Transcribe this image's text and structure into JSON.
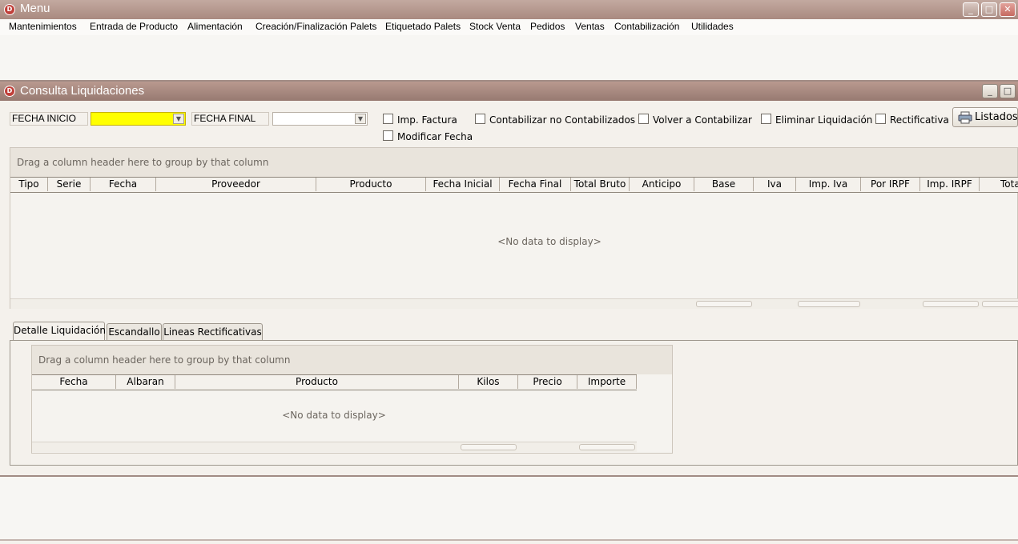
{
  "app": {
    "title": "Menu",
    "icon": "app-logo-icon",
    "accent": "#a98a80",
    "controls": {
      "minimize": "_",
      "maximize": "□",
      "close": "✕"
    }
  },
  "menu": {
    "items": [
      "Mantenimientos",
      "Entrada de Producto",
      "Alimentación",
      "Creación/Finalización Palets",
      "Etiquetado Palets",
      "Stock Venta",
      "Pedidos",
      "Ventas",
      "Contabilización",
      "Utilidades"
    ]
  },
  "child": {
    "title": "Consulta Liquidaciones",
    "controls": {
      "minimize": "_",
      "maximize": "□"
    }
  },
  "filters": {
    "fecha_inicio_label": "FECHA INICIO",
    "fecha_inicio_value": "",
    "fecha_final_label": "FECHA FINAL",
    "fecha_final_value": "",
    "highlight_color": "#ffff00",
    "checkboxes": {
      "imp_factura": "Imp. Factura",
      "modificar_fecha": "Modificar Fecha",
      "contabilizar": "Contabilizar no Contabilizados",
      "volver": "Volver a Contabilizar",
      "eliminar": "Eliminar Liquidación",
      "rectificativa": "Rectificativa"
    },
    "listados_label": "Listados"
  },
  "main_grid": {
    "group_hint": "Drag a column header here to group by that column",
    "columns": [
      "Tipo",
      "Serie",
      "Fecha",
      "Proveedor",
      "Producto",
      "Fecha Inicial",
      "Fecha Final",
      "Total Bruto",
      "Anticipo",
      "Base",
      "Iva",
      "Imp. Iva",
      "Por IRPF",
      "Imp. IRPF",
      "Tota"
    ],
    "empty_text": "<No data to display>"
  },
  "tabs": [
    "Detalle Liquidación",
    "Escandallo",
    "Lineas Rectificativas"
  ],
  "detail_grid": {
    "group_hint": "Drag a column header here to group by that column",
    "columns": [
      "Fecha",
      "Albaran",
      "Producto",
      "Kilos",
      "Precio",
      "Importe"
    ],
    "empty_text": "<No data to display>"
  }
}
